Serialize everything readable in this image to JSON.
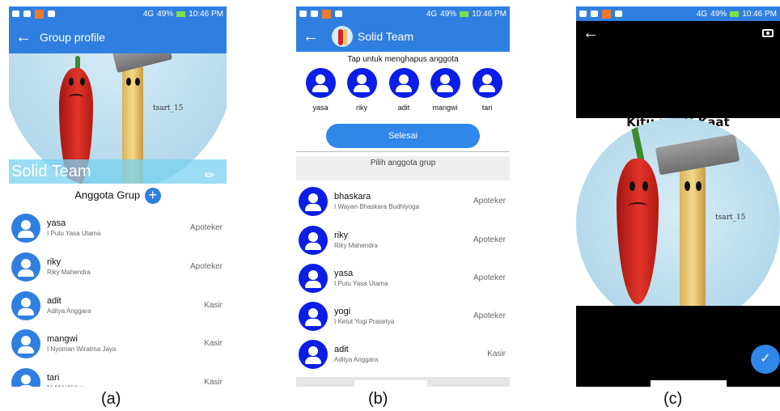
{
  "status_bar": {
    "battery": "49%",
    "time": "10:46 PM",
    "network": "4G"
  },
  "panel_a": {
    "caption": "(a)",
    "title": "Group profile",
    "team_name": "Solid Team",
    "art_signature": "tsart_15",
    "members_header": "Anggota Grup",
    "add_label": "+",
    "members": [
      {
        "name": "yasa",
        "fullname": "I Putu Yasa Utama",
        "role": "Apoteker"
      },
      {
        "name": "riky",
        "fullname": "Riky Mahendra",
        "role": "Apoteker"
      },
      {
        "name": "adit",
        "fullname": "Aditya Anggara",
        "role": "Kasir"
      },
      {
        "name": "mangwi",
        "fullname": "I Nyoman Wiratma Jaya",
        "role": "Kasir"
      },
      {
        "name": "tari",
        "fullname": "Ni Md Widya",
        "role": "Kasir"
      }
    ]
  },
  "panel_b": {
    "caption": "(b)",
    "title": "Solid Team",
    "instruction": "Tap untuk menghapus anggota",
    "selected": [
      "yasa",
      "riky",
      "adit",
      "mangwi",
      "tari"
    ],
    "done_label": "Selesai",
    "pick_label": "Pilih anggota grup",
    "candidates": [
      {
        "name": "bhaskara",
        "fullname": "I Wayan Bhaskara Budhiyoga",
        "role": "Apoteker"
      },
      {
        "name": "riky",
        "fullname": "Riky Mahendra",
        "role": "Apoteker"
      },
      {
        "name": "yasa",
        "fullname": "I Putu Yasa Utama",
        "role": "Apoteker"
      },
      {
        "name": "yogi",
        "fullname": "I Ketut Yogi Prasetya",
        "role": "Apoteker"
      },
      {
        "name": "adit",
        "fullname": "Aditya Anggara",
        "role": "Kasir"
      }
    ]
  },
  "panel_c": {
    "caption": "(c)",
    "image_text": "Kitu paati Kaat",
    "art_signature": "tsart_15",
    "confirm_label": "✓"
  },
  "colors": {
    "primary": "#2f7fe0",
    "member_dark": "#0a1ee6",
    "accent_light": "#78d2f0"
  }
}
